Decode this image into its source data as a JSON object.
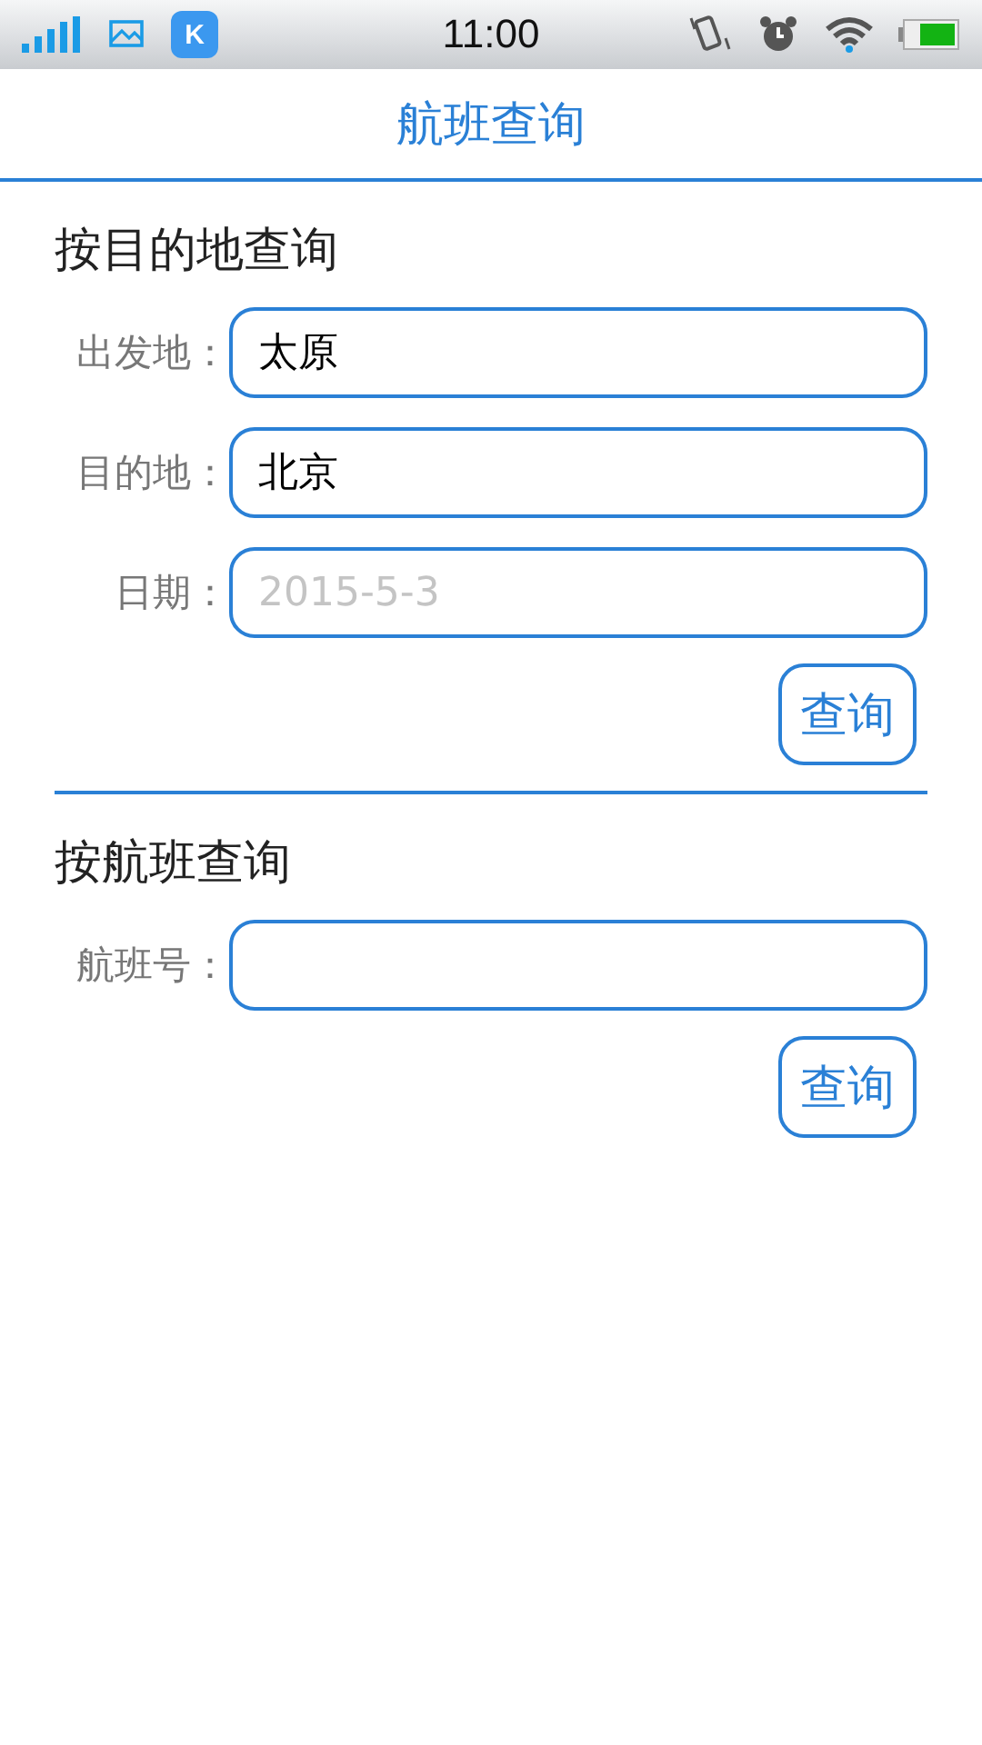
{
  "status_bar": {
    "app_badge": "K",
    "time": "11:00"
  },
  "title": "航班查询",
  "sections": [
    {
      "heading": "按目的地查询",
      "fields": [
        {
          "label": "出发地：",
          "value": "太原"
        },
        {
          "label": "目的地：",
          "value": "北京"
        },
        {
          "label": "日期：",
          "placeholder": "2015-5-3"
        }
      ],
      "button": "查询"
    },
    {
      "heading": "按航班查询",
      "fields": [
        {
          "label": "航班号："
        }
      ],
      "button": "查询"
    }
  ]
}
